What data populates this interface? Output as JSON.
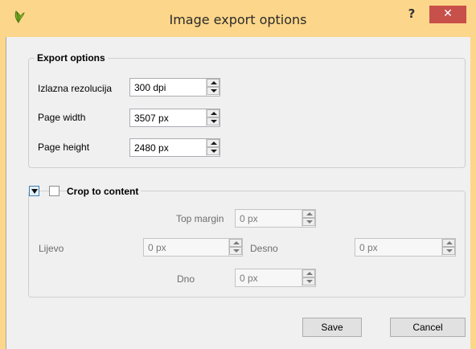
{
  "window": {
    "title": "Image export options",
    "help_label": "?",
    "close_label": "✕",
    "app_icon": "qgis-leaf-icon"
  },
  "export_options": {
    "legend": "Export options",
    "resolution_label": "Izlazna rezolucija",
    "resolution_value": "300 dpi",
    "page_width_label": "Page width",
    "page_width_value": "3507 px",
    "page_height_label": "Page height",
    "page_height_value": "2480 px"
  },
  "crop": {
    "label": "Crop to content",
    "checked": false,
    "top_margin_label": "Top margin",
    "top_margin_value": "0 px",
    "left_label": "Lijevo",
    "left_value": "0 px",
    "right_label": "Desno",
    "right_value": "0 px",
    "bottom_label": "Dno",
    "bottom_value": "0 px"
  },
  "buttons": {
    "save": "Save",
    "cancel": "Cancel"
  },
  "colors": {
    "title_bar": "#fcd68a",
    "close_button": "#c7504a",
    "dialog_background": "#f0f0f0"
  }
}
